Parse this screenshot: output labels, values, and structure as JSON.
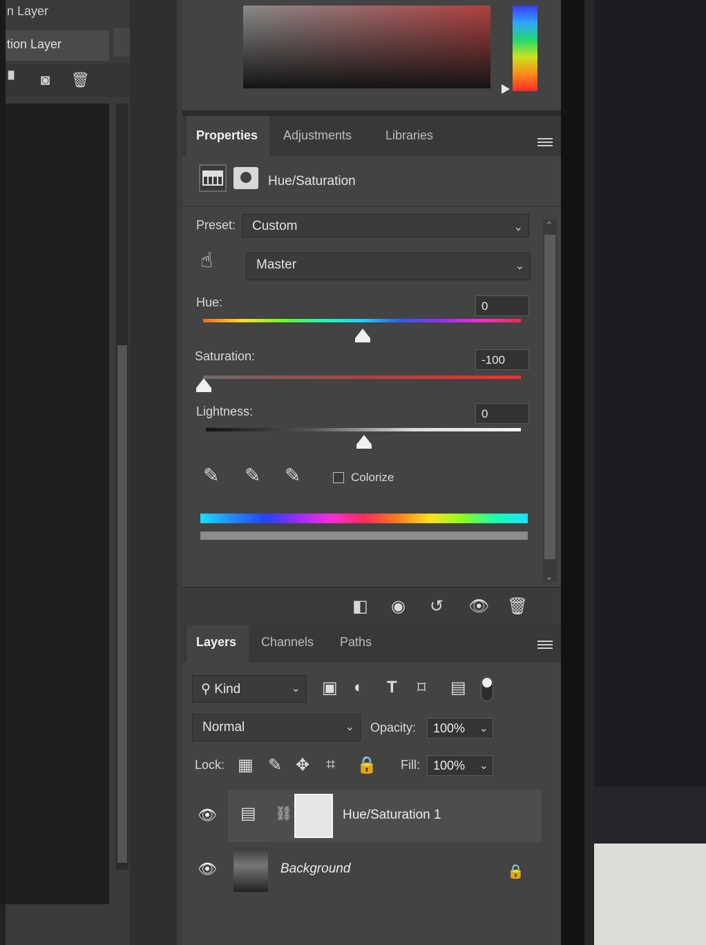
{
  "left_panel": {
    "row1_text": "n Layer",
    "row2_text": "tion Layer",
    "icons": [
      "page-icon",
      "camera-icon",
      "trash-icon"
    ]
  },
  "properties": {
    "tabs": [
      "Properties",
      "Adjustments",
      "Libraries"
    ],
    "active_tab": "Properties",
    "adjustment_title": "Hue/Saturation",
    "preset_label": "Preset:",
    "preset_value": "Custom",
    "range_value": "Master",
    "hue_label": "Hue:",
    "hue_value": "0",
    "saturation_label": "Saturation:",
    "saturation_value": "-100",
    "lightness_label": "Lightness:",
    "lightness_value": "0",
    "colorize_label": "Colorize",
    "colorize_checked": false,
    "footer_icons": [
      "clip-to-layer-icon",
      "view-previous-icon",
      "reset-icon",
      "visibility-icon",
      "delete-icon"
    ]
  },
  "layers": {
    "tabs": [
      "Layers",
      "Channels",
      "Paths"
    ],
    "active_tab": "Layers",
    "filter_kind": "Kind",
    "blend_mode": "Normal",
    "opacity_label": "Opacity:",
    "opacity_value": "100%",
    "lock_label": "Lock:",
    "fill_label": "Fill:",
    "fill_value": "100%",
    "items": [
      {
        "name": "Hue/Saturation 1",
        "type": "adjustment",
        "selected": true,
        "visible": true
      },
      {
        "name": "Background",
        "type": "image",
        "selected": false,
        "visible": true,
        "locked": true
      }
    ]
  },
  "colors": {
    "panel_bg": "#434343",
    "tab_bar_bg": "#383838",
    "text": "#d6d6d6"
  }
}
